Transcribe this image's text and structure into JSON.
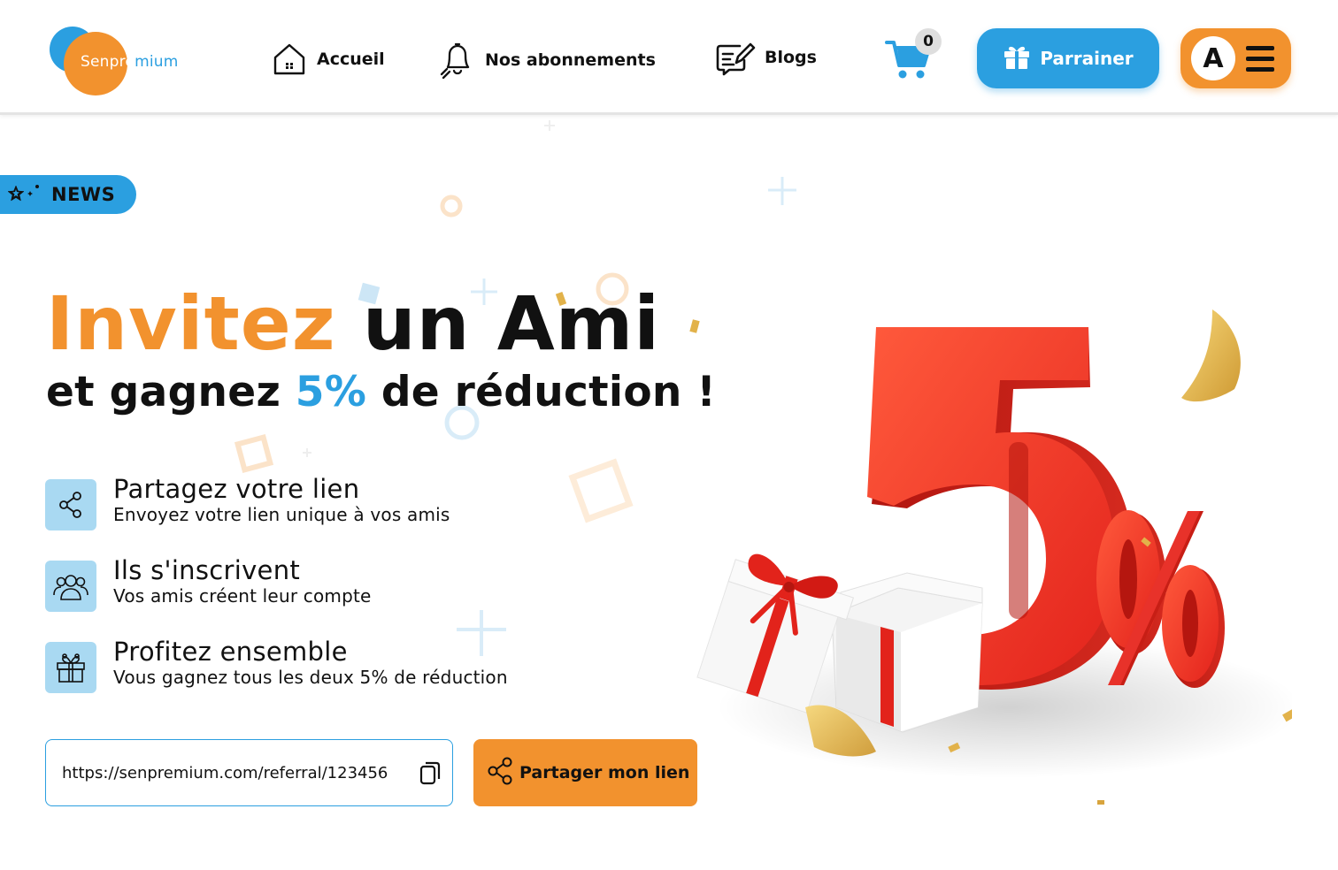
{
  "brand": {
    "logo_text_main": "Senpre",
    "logo_text_tail": "mium"
  },
  "nav": {
    "items": [
      {
        "label": "Accueil",
        "icon": "home-icon"
      },
      {
        "label": "Nos abonnements",
        "icon": "bell-icon"
      },
      {
        "label": "Blogs",
        "icon": "edit-note-icon"
      }
    ],
    "cart_count": "0",
    "parrainer_label": "Parrainer",
    "avatar_letter": "A"
  },
  "news": {
    "label": "NEWS"
  },
  "hero": {
    "headline_orange": "Invitez",
    "headline_black": "un Ami",
    "sub_before": "et gagnez",
    "sub_highlight": "5%",
    "sub_after": "de réduction !",
    "promo_big": "5",
    "promo_percent": "%"
  },
  "steps": [
    {
      "title": "Partagez votre lien",
      "desc": "Envoyez votre lien unique à vos amis",
      "icon": "share-icon"
    },
    {
      "title": "Ils s'inscrivent",
      "desc": "Vos amis créent leur compte",
      "icon": "users-icon"
    },
    {
      "title": "Profitez ensemble",
      "desc": "Vous gagnez tous les deux 5% de réduction",
      "icon": "gift-icon"
    }
  ],
  "referral": {
    "url": "https://senpremium.com/referral/123456",
    "share_label": "Partager mon lien"
  },
  "colors": {
    "brand_orange": "#f2922e",
    "brand_blue": "#2b9fe0",
    "promo_red": "#e8322a"
  }
}
